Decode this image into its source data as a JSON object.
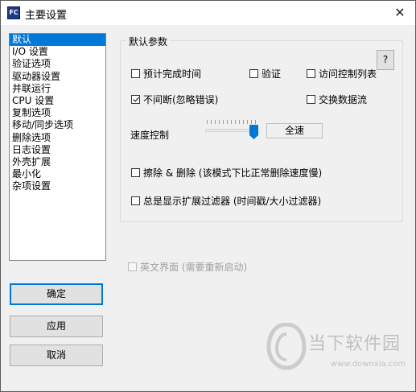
{
  "window": {
    "title": "主要设置",
    "app_icon_text": "FC",
    "close_label": "✕"
  },
  "nav": {
    "items": [
      "默认",
      "I/O 设置",
      "验证选项",
      "驱动器设置",
      "并联运行",
      "CPU 设置",
      "复制选项",
      "移动/同步选项",
      "删除选项",
      "日志设置",
      "外壳扩展",
      "最小化",
      "杂项设置"
    ],
    "selected_index": 0
  },
  "buttons": {
    "ok": "确定",
    "apply": "应用",
    "cancel": "取消",
    "help": "?"
  },
  "group": {
    "title": "默认参数"
  },
  "options": {
    "estimate_time": {
      "label": "预计完成时间",
      "checked": false
    },
    "verify": {
      "label": "验证",
      "checked": false
    },
    "acl": {
      "label": "访问控制列表",
      "checked": false
    },
    "continue_on_error": {
      "label": "不间断(忽略错误)",
      "checked": true
    },
    "exchange_stream": {
      "label": "交换数据流",
      "checked": false
    },
    "wipe_delete": {
      "label": "擦除 & 删除 (该模式下比正常删除速度慢)",
      "checked": false
    },
    "show_filters": {
      "label": "总是显示扩展过滤器 (时间戳/大小过滤器)",
      "checked": false
    },
    "english_ui": {
      "label": "英文界面 (需要重新启动)",
      "checked": false
    }
  },
  "speed": {
    "label": "速度控制",
    "value_label": "全速",
    "level": 1.0
  },
  "watermark": {
    "text": "当下软件园",
    "url": "www.downxia.com"
  }
}
